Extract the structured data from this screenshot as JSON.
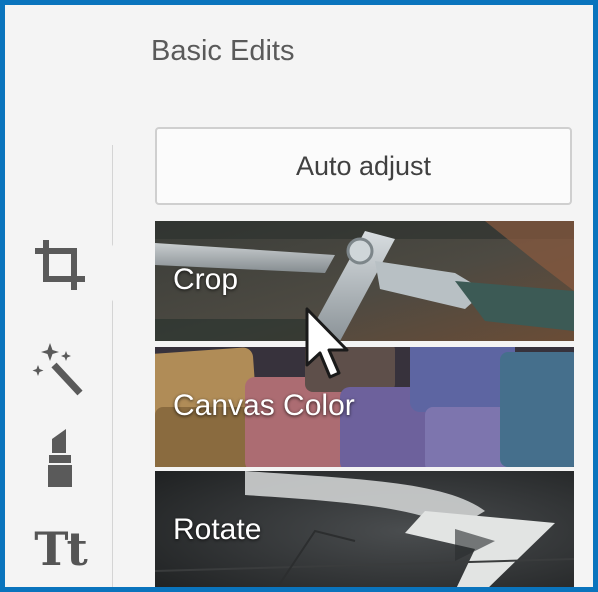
{
  "panel": {
    "title": "Basic Edits",
    "auto_adjust_label": "Auto adjust"
  },
  "toolbar": {
    "tools": [
      {
        "icon": "crop-icon",
        "active": true
      },
      {
        "icon": "magic-wand-icon",
        "active": false
      },
      {
        "icon": "lipstick-icon",
        "active": false
      },
      {
        "icon": "text-icon",
        "glyph": "Tt",
        "active": false
      }
    ]
  },
  "edits": [
    {
      "label": "Crop"
    },
    {
      "label": "Canvas Color"
    },
    {
      "label": "Rotate"
    }
  ],
  "colors": {
    "frame_border": "#0a74bd",
    "panel_bg": "#f4f4f4",
    "icon": "#555555",
    "title_text": "#5a5a5a"
  }
}
